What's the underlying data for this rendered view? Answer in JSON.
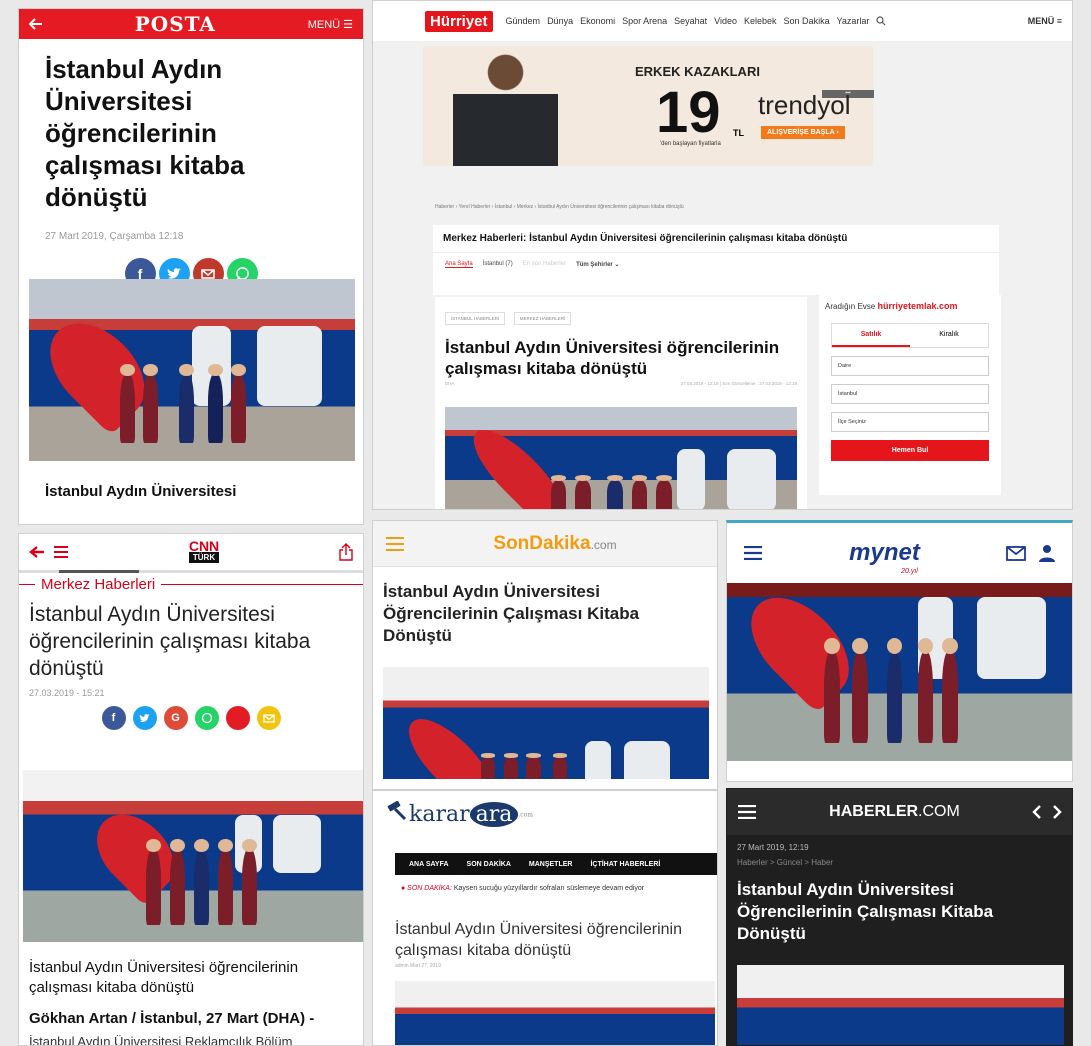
{
  "colors": {
    "posta_red": "#e41b23",
    "hurriyet_red": "#e4151b",
    "cnn_red": "#d9001b",
    "sondakika_orange": "#f39c12",
    "mynet_blue": "#1a3a8f",
    "haberler_dark": "#1f1f1f",
    "facebook": "#3b5998",
    "twitter": "#1da1f2",
    "google": "#dd4b39",
    "whatsapp": "#25d366",
    "mail_red": "#c0392b",
    "mail_yellow": "#f1c40f"
  },
  "posta": {
    "back_icon": "arrow-left-icon",
    "logo": "POSTA",
    "menu": "MENÜ ☰",
    "title": "İstanbul Aydın Üniversitesi öğrencilerinin çalışması kitaba dönüştü",
    "date": "27 Mart 2019, Çarşamba 12:18",
    "share": [
      "facebook-icon",
      "twitter-icon",
      "mail-icon",
      "whatsapp-icon"
    ],
    "caption": "İstanbul Aydın Üniversitesi"
  },
  "hurriyet": {
    "logo": "Hürriyet",
    "nav": [
      "Gündem",
      "Dünya",
      "Ekonomi",
      "Spor Arena",
      "Seyahat",
      "Video",
      "Kelebek",
      "Son Dakika",
      "Yazarlar"
    ],
    "menu": "MENÜ ≡",
    "ad": {
      "headline": "ERKEK KAZAKLARI",
      "price": "19",
      "currency": "TL",
      "note": "'den başlayan fiyatlarla",
      "brand": "trendyol",
      "cta": "ALIŞVERİŞE BAŞLA ›"
    },
    "breadcrumb": "Haberler  ›  Yerel Haberler  ›  İstanbul  ›  Merkez  ›  İstanbul Aydın Üniversitesi öğrencilerinin çalışması kitaba dönüştü",
    "category_title": "Merkez Haberleri: İstanbul Aydın Üniversitesi öğrencilerinin çalışması kitaba dönüştü",
    "tabs": [
      "Ana Sayfa",
      "İstanbul (7)",
      "En son Haberler",
      "Tüm Şehirler ⌄"
    ],
    "tags": [
      "İSTANBUL HABERLERİ",
      "MERKEZ HABERLERİ"
    ],
    "article_title": "İstanbul Aydın Üniversitesi öğrencilerinin çalışması kitaba dönüştü",
    "source": "DHA",
    "meta": "27.03.2019 - 12:18 | Son Güncelleme : 27.03.2019 - 12:19",
    "sidebar": {
      "prompt": "Aradığın Evse",
      "brand": "hürriyetemlak.com",
      "tab_sale": "Satılık",
      "tab_rent": "Kiralık",
      "select_type": "Daire",
      "select_city": "İstanbul",
      "select_district": "İlçe Seçiniz",
      "search_button": "Hemen Bul"
    }
  },
  "cnn": {
    "logo": "CNN",
    "logo_sub": "TÜRK",
    "category": "Merkez Haberleri",
    "title": "İstanbul Aydın Üniversitesi öğrencilerinin çalışması kitaba dönüştü",
    "date": "27.03.2019 - 15:21",
    "subtitle": "İstanbul Aydın Üniversitesi öğrencilerinin çalışması kitaba dönüştü",
    "byline": "Gökhan Artan / İstanbul, 27 Mart (DHA) -",
    "body": "İstanbul Aydın Üniversitesi Reklamcılık Bölüm"
  },
  "sondakika": {
    "logo": "SonDakika",
    "logo_suffix": ".com",
    "title": "İstanbul Aydın Üniversitesi Öğrencilerinin Çalışması Kitaba Dönüştü"
  },
  "karar": {
    "logo_pre": "karar",
    "logo_mid": "ara",
    "logo_suffix": ".com",
    "nav": [
      "ANA SAYFA",
      "SON DAKİKA",
      "MANŞETLER",
      "İÇTİHAT HABERLERİ"
    ],
    "ticker_label": "● SON DAKİKA:",
    "ticker_text": "Kayseri sucuğu yüzyıllardır sofraları süslemeye devam ediyor",
    "title": "İstanbul Aydın Üniversitesi öğrencilerinin çalışması kitaba dönüştü",
    "meta": "admin   Mart 27, 2019"
  },
  "mynet": {
    "logo": "mynet",
    "logo_sub": "20.yıl"
  },
  "haberler": {
    "logo_bold": "HABERLER",
    "logo_light": ".COM",
    "date": "27 Mart 2019, 12:19",
    "breadcrumb": "Haberler  >  Güncel  >  Haber",
    "title": "İstanbul Aydın Üniversitesi Öğrencilerinin Çalışması Kitaba Dönüştü"
  }
}
